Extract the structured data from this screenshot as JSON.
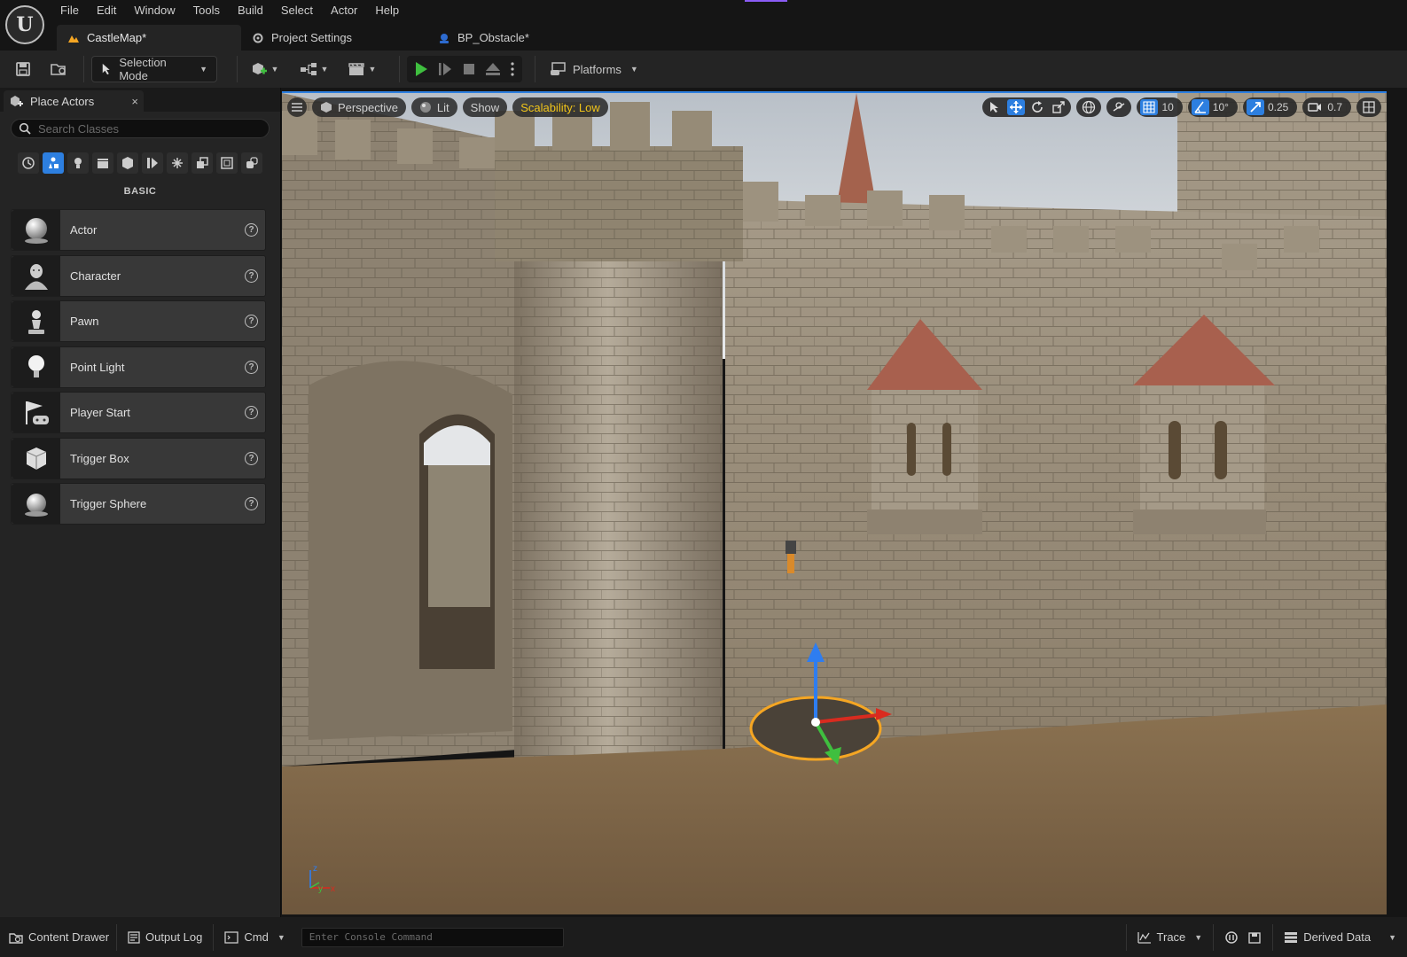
{
  "app": {
    "logo_text": "U"
  },
  "menu": [
    "File",
    "Edit",
    "Window",
    "Tools",
    "Build",
    "Select",
    "Actor",
    "Help"
  ],
  "doc_tabs": [
    {
      "label": "CastleMap*",
      "icon": "map-icon"
    },
    {
      "label": "Project Settings",
      "icon": "gear-icon"
    },
    {
      "label": "BP_Obstacle*",
      "icon": "blueprint-icon"
    }
  ],
  "toolbar": {
    "selection_mode": "Selection Mode",
    "platforms": "Platforms"
  },
  "place_actors": {
    "tab_label": "Place Actors",
    "close_glyph": "×",
    "search_placeholder": "Search Classes",
    "category_title": "BASIC",
    "items": [
      {
        "label": "Actor",
        "icon": "sphere-icon"
      },
      {
        "label": "Character",
        "icon": "character-icon"
      },
      {
        "label": "Pawn",
        "icon": "pawn-icon"
      },
      {
        "label": "Point Light",
        "icon": "lightbulb-icon"
      },
      {
        "label": "Player Start",
        "icon": "player-start-icon"
      },
      {
        "label": "Trigger Box",
        "icon": "trigger-box-icon"
      },
      {
        "label": "Trigger Sphere",
        "icon": "trigger-sphere-icon"
      }
    ],
    "help_glyph": "?"
  },
  "viewport": {
    "perspective": "Perspective",
    "lit": "Lit",
    "show": "Show",
    "scalability": "Scalability: Low",
    "grid_snap": "10",
    "rotation_snap": "10°",
    "scale_snap": "0.25",
    "camera_speed": "0.7",
    "axis_labels": {
      "x": "x",
      "y": "y",
      "z": "z"
    }
  },
  "bottom_bar": {
    "content_drawer": "Content Drawer",
    "output_log": "Output Log",
    "cmd": "Cmd",
    "console_placeholder": "Enter Console Command",
    "trace": "Trace",
    "derived_data": "Derived Data"
  },
  "colors": {
    "accent_blue": "#2d7fe0",
    "play_green": "#3fbf3f",
    "scalability_yellow": "#f0c419",
    "selection_orange": "#f5a623"
  }
}
